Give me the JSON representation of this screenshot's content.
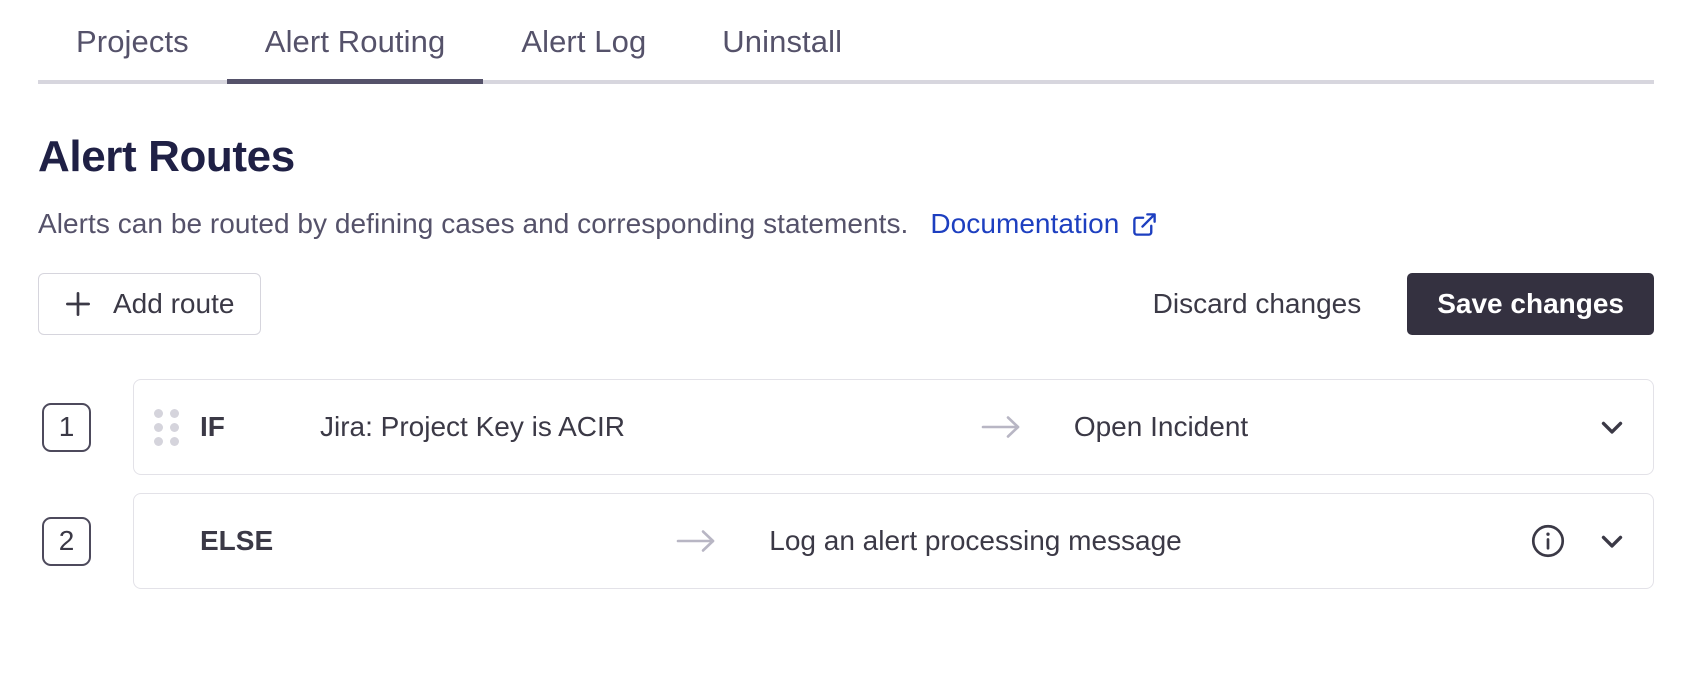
{
  "tabs": [
    {
      "label": "Projects",
      "active": false
    },
    {
      "label": "Alert Routing",
      "active": true
    },
    {
      "label": "Alert Log",
      "active": false
    },
    {
      "label": "Uninstall",
      "active": false
    }
  ],
  "page": {
    "title": "Alert Routes",
    "description": "Alerts can be routed by defining cases and corresponding statements.",
    "doc_link_label": "Documentation",
    "doc_link_icon": "external-link-icon"
  },
  "toolbar": {
    "add_route_label": "Add route",
    "add_route_icon": "plus-icon",
    "discard_label": "Discard changes",
    "save_label": "Save changes"
  },
  "colors": {
    "accent_link": "#1d3fc0",
    "save_button_bg": "#343140",
    "text_primary": "#3b3946",
    "title": "#1f2045",
    "tab_active_underline": "#55526a",
    "card_border": "#e3e2e8",
    "arrow": "#b8b6c4",
    "drag_dot": "#d5d4dc"
  },
  "routes": [
    {
      "index": "1",
      "keyword": "IF",
      "condition": "Jira: Project Key is ACIR",
      "arrow_icon": "arrow-right-icon",
      "action": "Open Incident",
      "has_drag_handle": true,
      "has_info_icon": false,
      "chevron_icon": "chevron-down-icon"
    },
    {
      "index": "2",
      "keyword": "ELSE",
      "condition": "",
      "arrow_icon": "arrow-right-icon",
      "action": "Log an alert processing message",
      "has_drag_handle": false,
      "has_info_icon": true,
      "info_icon": "info-circle-icon",
      "chevron_icon": "chevron-down-icon"
    }
  ]
}
